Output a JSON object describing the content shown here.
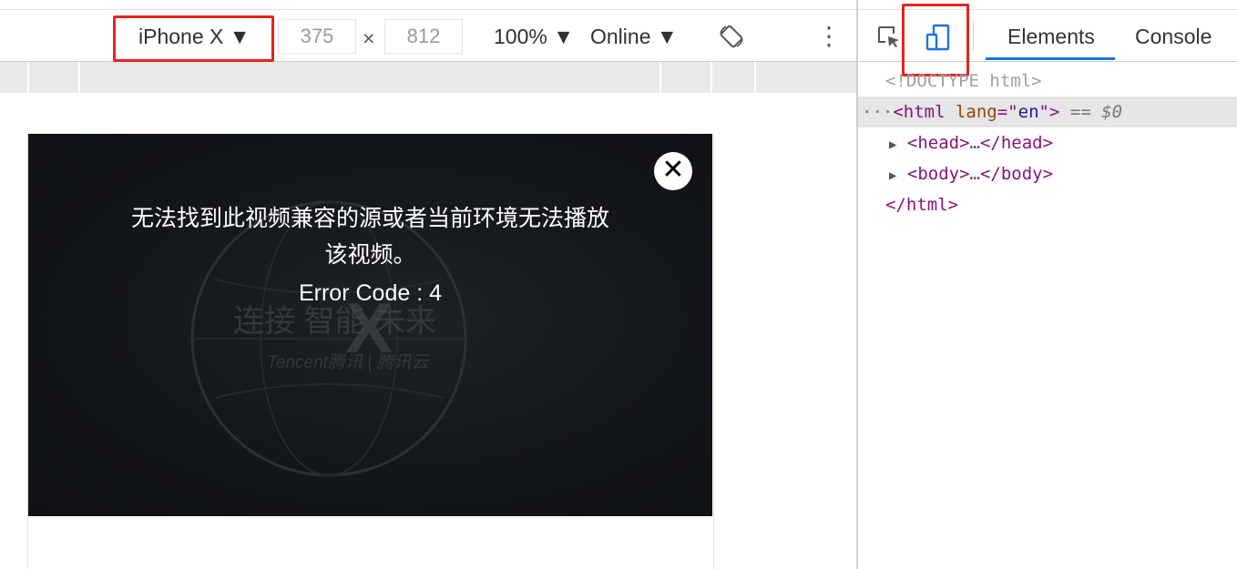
{
  "device_toolbar": {
    "device_name": "iPhone X ▼",
    "width_value": "375",
    "times_sign": "×",
    "height_value": "812",
    "zoom": "100% ▼",
    "network": "Online ▼",
    "more_icon": "⋮"
  },
  "video": {
    "error_line1": "无法找到此视频兼容的源或者当前环境无法播放",
    "error_line2": "该视频。",
    "error_code": "Error Code : 4",
    "close_icon": "✕",
    "watermark_slogan": "连接   智能   未来",
    "watermark_brand": "Tencent腾讯  |  腾讯云"
  },
  "devtools": {
    "tabs": [
      "Elements",
      "Console"
    ],
    "active_tab": "Elements",
    "dom": {
      "doctype": "<!DOCTYPE html>",
      "html_prefix": "···",
      "html_open_tag": "<html",
      "html_attr_name": "lang",
      "html_attr_eq": "=\"",
      "html_attr_value": "en",
      "html_attr_close": "\">",
      "html_selected_marker": "== $0",
      "head_arrow": "▶",
      "head_open": "<head>",
      "ellipsis1": "…",
      "head_close": "</head>",
      "body_arrow": "▶",
      "body_open": "<body>",
      "ellipsis2": "…",
      "body_close": "</body>",
      "html_close": "</html>"
    }
  },
  "colors": {
    "highlight_red": "#e8231f",
    "accent_blue": "#1a73e8",
    "video_bg": "#14171b"
  }
}
